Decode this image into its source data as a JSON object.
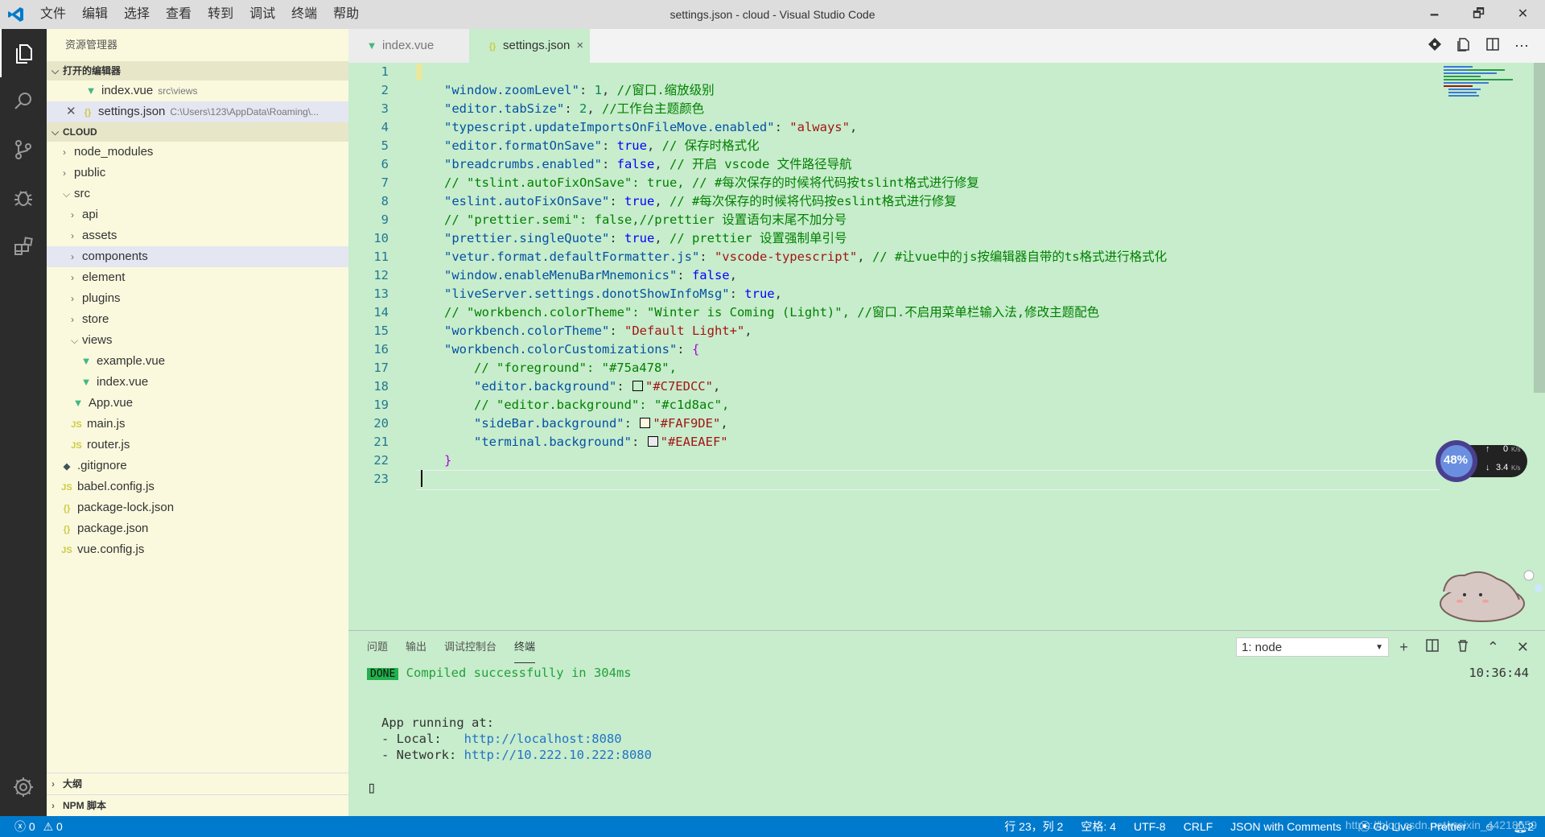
{
  "window": {
    "title": "settings.json - cloud - Visual Studio Code",
    "menu": [
      "文件",
      "编辑",
      "选择",
      "查看",
      "转到",
      "调试",
      "终端",
      "帮助"
    ],
    "minimize": "🗕",
    "maximize": "🗗",
    "close": "✕"
  },
  "sidebar": {
    "title": "资源管理器",
    "open_editors": {
      "label": "打开的编辑器",
      "items": [
        {
          "name": "index.vue",
          "path": "src\\views",
          "icon": "vue-icon"
        },
        {
          "name": "settings.json",
          "path": "C:\\Users\\123\\AppData\\Roaming\\...",
          "icon": "json-icon"
        }
      ]
    },
    "project": {
      "label": "CLOUD",
      "items": [
        {
          "name": "node_modules"
        },
        {
          "name": "public"
        },
        {
          "name": "src"
        },
        {
          "name": "api"
        },
        {
          "name": "assets"
        },
        {
          "name": "components"
        },
        {
          "name": "element"
        },
        {
          "name": "plugins"
        },
        {
          "name": "store"
        },
        {
          "name": "views"
        },
        {
          "name": "example.vue"
        },
        {
          "name": "index.vue"
        },
        {
          "name": "App.vue"
        },
        {
          "name": "main.js"
        },
        {
          "name": "router.js"
        },
        {
          "name": ".gitignore"
        },
        {
          "name": "babel.config.js"
        },
        {
          "name": "package-lock.json"
        },
        {
          "name": "package.json"
        },
        {
          "name": "vue.config.js"
        }
      ]
    },
    "outline_label": "大纲",
    "npm_label": "NPM 脚本"
  },
  "tabs": [
    {
      "label": "index.vue"
    },
    {
      "label": "settings.json",
      "close": "×"
    }
  ],
  "line_numbers": [
    "1",
    "2",
    "3",
    "4",
    "5",
    "6",
    "7",
    "8",
    "9",
    "10",
    "11",
    "12",
    "13",
    "14",
    "15",
    "16",
    "17",
    "18",
    "19",
    "20",
    "21",
    "22",
    "23"
  ],
  "code": {
    "l2k": "\"window.zoomLevel\"",
    "l2v": "1",
    "l2c": "//窗口.缩放级别",
    "l3k": "\"editor.tabSize\"",
    "l3v": "2",
    "l3c": "//工作台主题颜色",
    "l4k": "\"typescript.updateImportsOnFileMove.enabled\"",
    "l4v": "\"always\"",
    "l5k": "\"editor.formatOnSave\"",
    "l5v": "true",
    "l5c": "// 保存时格式化",
    "l6k": "\"breadcrumbs.enabled\"",
    "l6v": "false",
    "l6c": "// 开启 vscode 文件路径导航",
    "l7c": "// \"tslint.autoFixOnSave\": true, // #每次保存的时候将代码按tslint格式进行修复",
    "l8k": "\"eslint.autoFixOnSave\"",
    "l8v": "true",
    "l8c": "// #每次保存的时候将代码按eslint格式进行修复",
    "l9c": "// \"prettier.semi\": false,//prettier 设置语句末尾不加分号",
    "l10k": "\"prettier.singleQuote\"",
    "l10v": "true",
    "l10c": "// prettier 设置强制单引号",
    "l11k": "\"vetur.format.defaultFormatter.js\"",
    "l11v": "\"vscode-typescript\"",
    "l11c": "// #让vue中的js按编辑器自带的ts格式进行格式化",
    "l12k": "\"window.enableMenuBarMnemonics\"",
    "l12v": "false",
    "l13k": "\"liveServer.settings.donotShowInfoMsg\"",
    "l13v": "true",
    "l14c": "// \"workbench.colorTheme\": \"Winter is Coming (Light)\", //窗口.不启用菜单栏输入法,修改主题配色",
    "l15k": "\"workbench.colorTheme\"",
    "l15v": "\"Default Light+\"",
    "l16k": "\"workbench.colorCustomizations\"",
    "l17c": "// \"foreground\": \"#75a478\",",
    "l18k": "\"editor.background\"",
    "l18v": "\"#C7EDCC\"",
    "l19c": "// \"editor.background\": \"#c1d8ac\",",
    "l20k": "\"sideBar.background\"",
    "l20v": "\"#FAF9DE\"",
    "l21k": "\"terminal.background\"",
    "l21v": "\"#EAEAEF\""
  },
  "panel": {
    "tabs": [
      "问题",
      "输出",
      "调试控制台",
      "终端"
    ],
    "terminal_select": "1: node",
    "done_badge": "DONE",
    "compiled": "Compiled successfully in 304ms",
    "time": "10:36:44",
    "app_running": "App running at:",
    "local_label": "- Local:   ",
    "local_url": "http://localhost:8080",
    "network_label": "- Network: ",
    "network_url": "http://10.222.10.222:8080",
    "cursor": "▯"
  },
  "statusbar": {
    "errors": "0",
    "warnings": "0",
    "position": "行 23，列 2",
    "spaces": "空格: 4",
    "encoding": "UTF-8",
    "eol": "CRLF",
    "language": "JSON with Comments",
    "golive": "Go Live",
    "prettier": "Prettier",
    "notifications": "2",
    "watermark": "https://blog.csdn.net/weixin_44218659"
  },
  "widget": {
    "percent": "48%",
    "up": "0",
    "down": "3.4",
    "unit": "K/s"
  },
  "colors": {
    "editor_bg": "#C7EDCC",
    "sidebar_bg": "#FAF9DE",
    "statusbar_bg": "#007ACC",
    "activity_bg": "#2C2C2C"
  }
}
